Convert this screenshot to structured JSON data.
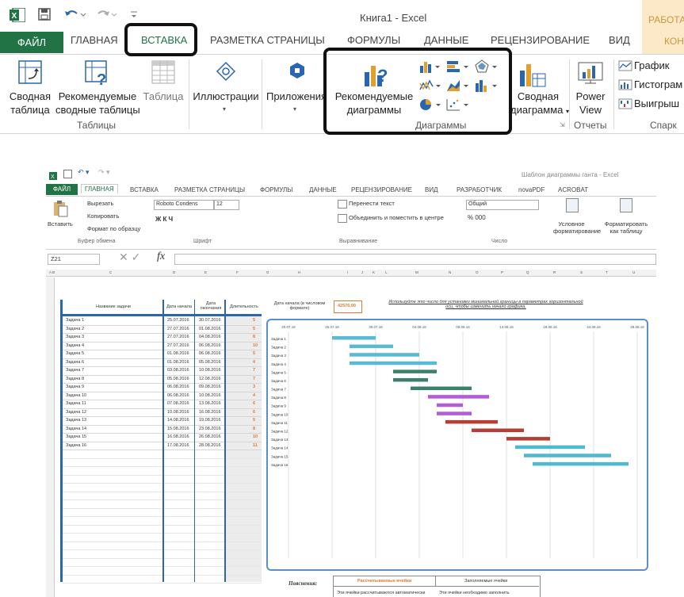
{
  "window": {
    "title": "Книга1 - Excel",
    "work_tab": "РАБОТА",
    "work_tab2": "КОН"
  },
  "tabs": [
    "ФАЙЛ",
    "ГЛАВНАЯ",
    "ВСТАВКА",
    "РАЗМЕТКА СТРАНИЦЫ",
    "ФОРМУЛЫ",
    "ДАННЫЕ",
    "РЕЦЕНЗИРОВАНИЕ",
    "ВИД"
  ],
  "ribbon": {
    "pivot_table": [
      "Сводная",
      "таблица"
    ],
    "recommended_pivot": [
      "Рекомендуемые",
      "сводные таблицы"
    ],
    "table": "Таблица",
    "tables_group": "Таблицы",
    "illustrations": "Иллюстрации",
    "apps": "Приложения",
    "recommended_charts": [
      "Рекомендуемые",
      "диаграммы"
    ],
    "charts_group": "Диаграммы",
    "pivot_chart": [
      "Сводная",
      "диаграмма"
    ],
    "power_view": [
      "Power",
      "View"
    ],
    "reports_group": "Отчеты",
    "sparkline_line": "График",
    "sparkline_column": "Гистограм",
    "sparkline_winloss": "Выигрыш",
    "sparklines_group": "Спарк"
  },
  "colors": {
    "excel_green": "#217346",
    "bar_blue": "#5bbad3",
    "bar_green": "#3d8068",
    "bar_purple": "#b25cd6",
    "bar_red": "#b53f35",
    "bar_teal": "#4fb9cf",
    "highlight": "#111111"
  },
  "shot2": {
    "title": "Шаблон диаграммы ганта - Excel",
    "tabs": [
      "ФАЙЛ",
      "ГЛАВНАЯ",
      "ВСТАВКА",
      "РАЗМЕТКА СТРАНИЦЫ",
      "ФОРМУЛЫ",
      "ДАННЫЕ",
      "РЕЦЕНЗИРОВАНИЕ",
      "ВИД",
      "РАЗРАБОТЧИК",
      "novaPDF",
      "ACROBAT"
    ],
    "paste": "Вставить",
    "cut": "Вырезать",
    "copy": "Копировать",
    "format_painter": "Формат по образцу",
    "clipboard_group": "Буфер обмена",
    "font_name": "Roboto Condens",
    "font_size": "12",
    "font_group": "Шрифт",
    "wrap_text": "Перенести текст",
    "merge_center": "Объединить и поместить в центре",
    "alignment_group": "Выравнивание",
    "number_format": "Общий",
    "number_group": "Число",
    "cond_format": [
      "Условное",
      "форматирование"
    ],
    "format_table": [
      "Форматировать",
      "как таблицу"
    ],
    "name_box": "Z21",
    "fx": "fx",
    "columns": [
      "A B",
      "C",
      "D",
      "E",
      "F",
      "G",
      "H",
      "I",
      "J",
      "K",
      "L",
      "M",
      "N",
      "O",
      "P",
      "Q",
      "R",
      "S",
      "T",
      "U"
    ],
    "table_headers": [
      "Название задачи",
      "Дата начала",
      "Дата окончания",
      "Длительность"
    ],
    "tasks": [
      {
        "name": "Задача 1",
        "start": "25.07.2016",
        "end": "30.07.2016",
        "dur": "5"
      },
      {
        "name": "Задача 2",
        "start": "27.07.2016",
        "end": "01.08.2016",
        "dur": "5"
      },
      {
        "name": "Задача 3",
        "start": "27.07.2016",
        "end": "04.08.2016",
        "dur": "8"
      },
      {
        "name": "Задача 4",
        "start": "27.07.2016",
        "end": "06.08.2016",
        "dur": "10"
      },
      {
        "name": "Задача 5",
        "start": "01.08.2016",
        "end": "06.08.2016",
        "dur": "5"
      },
      {
        "name": "Задача 6",
        "start": "01.08.2016",
        "end": "05.08.2016",
        "dur": "4"
      },
      {
        "name": "Задача 7",
        "start": "03.08.2016",
        "end": "10.08.2016",
        "dur": "7"
      },
      {
        "name": "Задача 8",
        "start": "05.08.2016",
        "end": "12.08.2016",
        "dur": "7"
      },
      {
        "name": "Задача 9",
        "start": "06.08.2016",
        "end": "09.08.2016",
        "dur": "3"
      },
      {
        "name": "Задача 10",
        "start": "06.08.2016",
        "end": "10.08.2016",
        "dur": "4"
      },
      {
        "name": "Задача 11",
        "start": "07.08.2016",
        "end": "13.08.2016",
        "dur": "6"
      },
      {
        "name": "Задача 12",
        "start": "10.08.2016",
        "end": "16.08.2016",
        "dur": "6"
      },
      {
        "name": "Задача 13",
        "start": "14.08.2016",
        "end": "19.08.2016",
        "dur": "5"
      },
      {
        "name": "Задача 14",
        "start": "15.08.2016",
        "end": "23.08.2016",
        "dur": "8"
      },
      {
        "name": "Задача 15",
        "start": "16.08.2016",
        "end": "26.08.2016",
        "dur": "10"
      },
      {
        "name": "Задача 16",
        "start": "17.08.2016",
        "end": "28.08.2016",
        "dur": "11"
      }
    ],
    "start_label": [
      "Дата начала (в числовом",
      "формате)"
    ],
    "start_value": "42576,00",
    "hint": [
      "Используйте это число для установки минимальной границы в параметрах горизонтальной",
      "оси, чтобы изменить начало графика."
    ],
    "legend_title": "Пояснения:",
    "legend_calc": "Рассчитываемые ячейки",
    "legend_fill": "Заполняемые ячейки",
    "legend_calc_desc": "Эти ячейки рассчитываются автоматически",
    "legend_fill_desc": "Эти ячейки необходимо заполнить"
  },
  "chart_data": {
    "type": "bar",
    "orientation": "horizontal",
    "stacked_gantt": true,
    "categories": [
      "Задача 1",
      "Задача 2",
      "Задача 3",
      "Задача 4",
      "Задача 5",
      "Задача 6",
      "Задача 7",
      "Задача 8",
      "Задача 9",
      "Задача 10",
      "Задача 11",
      "Задача 12",
      "Задача 13",
      "Задача 14",
      "Задача 15",
      "Задача 16"
    ],
    "start": [
      "25.07.2016",
      "27.07.2016",
      "27.07.2016",
      "27.07.2016",
      "01.08.2016",
      "01.08.2016",
      "03.08.2016",
      "05.08.2016",
      "06.08.2016",
      "06.08.2016",
      "07.08.2016",
      "10.08.2016",
      "14.08.2016",
      "15.08.2016",
      "16.08.2016",
      "17.08.2016"
    ],
    "duration": [
      5,
      5,
      8,
      10,
      5,
      4,
      7,
      7,
      3,
      4,
      6,
      6,
      5,
      8,
      10,
      11
    ],
    "x_ticks": [
      "20.07.16",
      "25.07.16",
      "30.07.16",
      "04.08.16",
      "09.08.16",
      "14.08.16",
      "19.08.16",
      "24.08.16",
      "29.08.16"
    ],
    "xlim": [
      "20.07.16",
      "29.08.16"
    ],
    "bar_colors": [
      "#5bbad3",
      "#5bbad3",
      "#5bbad3",
      "#5bbad3",
      "#3d8068",
      "#3d8068",
      "#3d8068",
      "#b25cd6",
      "#b25cd6",
      "#b25cd6",
      "#b53f35",
      "#b53f35",
      "#b53f35",
      "#4fb9cf",
      "#4fb9cf",
      "#4fb9cf"
    ],
    "grid": true
  }
}
